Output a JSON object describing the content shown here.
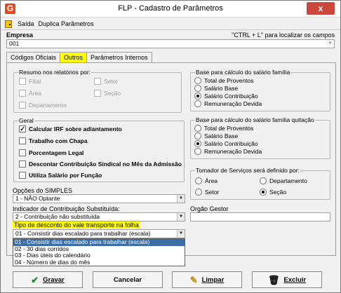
{
  "window": {
    "title": "FLP - Cadastro de Parâmetros",
    "close_label": "x",
    "app_icon_letter": "G"
  },
  "menu": {
    "items": [
      {
        "label": "Saída"
      },
      {
        "label": "Duplica Parâmetros"
      }
    ]
  },
  "empresa": {
    "label": "Empresa",
    "hint": "\"CTRL + L\" para localizar os campos",
    "value": "001"
  },
  "tabs": [
    {
      "label": "Códigos Oficiais"
    },
    {
      "label": "Outros"
    },
    {
      "label": "Parâmetros Internos"
    }
  ],
  "resumo": {
    "title": "Resumo nos relatórios por:",
    "items": [
      {
        "label": "Filial"
      },
      {
        "label": "Setor"
      },
      {
        "label": "Área"
      },
      {
        "label": "Seção"
      },
      {
        "label": "Departamento"
      }
    ]
  },
  "geral": {
    "title": "Geral",
    "check_mark": "✓",
    "items": [
      {
        "label": "Calcular IRF sobre adiantamento",
        "checked": true
      },
      {
        "label": "Trabalho com Chapa",
        "checked": false
      },
      {
        "label": "Porcentagem Legal",
        "checked": false
      },
      {
        "label": "Descontar Contribuição Sindical no Mês da  Admissão",
        "checked": false
      },
      {
        "label": "Utiliza Salário por Função",
        "checked": false
      }
    ]
  },
  "base_familia": {
    "title": "Base para cálculo do salário família",
    "options": [
      "Total de Proventos",
      "Salário Base",
      "Salário Contribuição",
      "Remuneração Devida"
    ],
    "selected": "Salário Contribuição"
  },
  "base_quitacao": {
    "title": "Base para cálculo do salário família quitação",
    "options": [
      "Total de Proventos",
      "Salário Base",
      "Salário Contribuição",
      "Remuneração Devida"
    ],
    "selected": "Salário Contribuição"
  },
  "tomador": {
    "title": "Tomador de Serviços será definido por:",
    "options": [
      "Área",
      "Departamento",
      "Setor",
      "Seção"
    ],
    "selected": "Seção"
  },
  "simples": {
    "label": "Opções do SIMPLES",
    "value": "1 - NÃO Optante"
  },
  "contribuicao": {
    "label": "Indicador de Contribuição Substituída:",
    "value": "2 - Contribuição não substituída"
  },
  "orgao": {
    "label": "Orgão Gestor",
    "value": ""
  },
  "vale": {
    "label": "Tipo de desconto do vale transporte na folha",
    "value": "01 - Consistir dias escalado para trabalhar (escala)",
    "options": [
      "01 - Consistir dias escalado para trabalhar (escala)",
      "02 - 30 dias corridos",
      "03 - Dias úteis do calendário",
      "04 - Número de dias do mês"
    ],
    "highlight_color": "#ffff00",
    "selected_color": "#3a6ea5"
  },
  "buttons": {
    "gravar": "Gravar",
    "cancelar": "Cancelar",
    "limpar": "Limpar",
    "excluir": "Excluir"
  }
}
